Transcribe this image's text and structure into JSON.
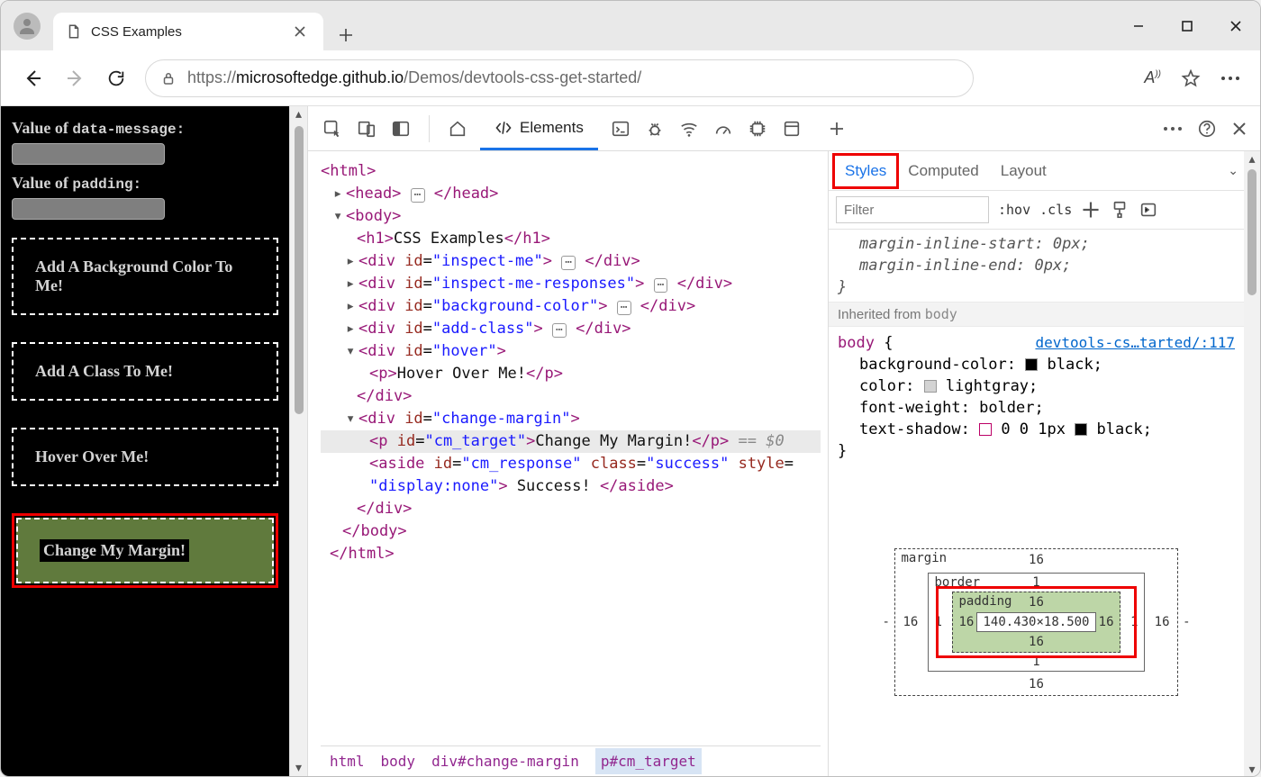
{
  "tab": {
    "title": "CSS Examples"
  },
  "url": {
    "prefix": "https://",
    "host": "microsoftedge.github.io",
    "path": "/Demos/devtools-css-get-started/"
  },
  "page": {
    "labels": {
      "data_message_prefix": "Value of ",
      "data_message_mono": "data-message:",
      "padding_prefix": "Value of ",
      "padding_mono": "padding:"
    },
    "boxes": {
      "bg": "Add A Background Color To Me!",
      "addclass": "Add A Class To Me!",
      "hover": "Hover Over Me!",
      "change": "Change My Margin!"
    }
  },
  "devtools": {
    "top": {
      "elements": "Elements"
    },
    "tree": {
      "html_open": "<html>",
      "head": "<head>",
      "head_close": "</head>",
      "body_open": "<body>",
      "h1_open": "<h1>",
      "h1_text": "CSS Examples",
      "h1_close": "</h1>",
      "div_inspect": "inspect-me",
      "div_inspect_resp": "inspect-me-responses",
      "div_bg": "background-color",
      "div_addclass": "add-class",
      "div_hover": "hover",
      "p_hover": "Hover Over Me!",
      "div_change": "change-margin",
      "p_cm_id": "cm_target",
      "p_cm_text": "Change My Margin!",
      "p_cm_anno": "== $0",
      "aside_id": "cm_response",
      "aside_class": "success",
      "aside_style": "display:none",
      "aside_text": " Success! ",
      "body_close": "</body>",
      "html_close": "</html>"
    },
    "breadcrumb": [
      "html",
      "body",
      "div#change-margin",
      "p#cm_target"
    ],
    "styles_tabs": {
      "styles": "Styles",
      "computed": "Computed",
      "layout": "Layout"
    },
    "filter_placeholder": "Filter",
    "toolbar": {
      "hov": ":hov",
      "cls": ".cls"
    },
    "ua_rules": {
      "l1": "margin-inline-start: 0px;",
      "l2": "margin-inline-end: 0px;"
    },
    "inherited_label": "Inherited from ",
    "inherited_from": "body",
    "body_rule": {
      "selector": "body",
      "open": "{",
      "source": "devtools-cs…tarted/:117",
      "bg_prop": "background-color:",
      "bg_val": "black;",
      "color_prop": "color:",
      "color_val": "lightgray;",
      "fw_prop": "font-weight:",
      "fw_val": "bolder;",
      "ts_prop": "text-shadow:",
      "ts_val": "0 0 1px ",
      "ts_val2": "black;"
    },
    "boxmodel": {
      "margin_label": "margin",
      "border_label": "border",
      "padding_label": "padding",
      "margin": "16",
      "border": "1",
      "padding": "16",
      "content": "140.430×18.500",
      "outside": "-"
    }
  }
}
